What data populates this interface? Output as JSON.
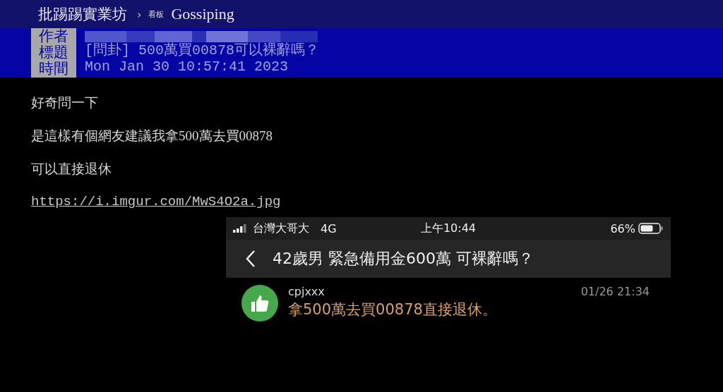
{
  "top_bar": {
    "site": "批踢踢實業坊",
    "separator": "›",
    "board_label": "看板",
    "board": "Gossiping"
  },
  "header": [
    {
      "label": "作者",
      "kind": "redacted"
    },
    {
      "label": "標題",
      "kind": "text",
      "value": "[問卦] 500萬買00878可以裸辭嗎？"
    },
    {
      "label": "時間",
      "kind": "text",
      "value": "Mon Jan 30 10:57:41 2023"
    }
  ],
  "body": [
    {
      "kind": "text",
      "text": "好奇問一下"
    },
    {
      "kind": "text",
      "text": "是這樣有個網友建議我拿500萬去買00878"
    },
    {
      "kind": "text",
      "text": "可以直接退休"
    },
    {
      "kind": "link",
      "text": "https://i.imgur.com/MwS4O2a.jpg"
    }
  ],
  "phone": {
    "carrier": "台灣大哥大",
    "network": "4G",
    "time": "上午10:44",
    "battery": "66%",
    "title": "42歲男 緊急備用金600萬 可裸辭嗎？",
    "comment": {
      "user": "cpjxxx",
      "date": "01/26 21:34",
      "text": "拿500萬去買00878直接退休。"
    }
  }
}
